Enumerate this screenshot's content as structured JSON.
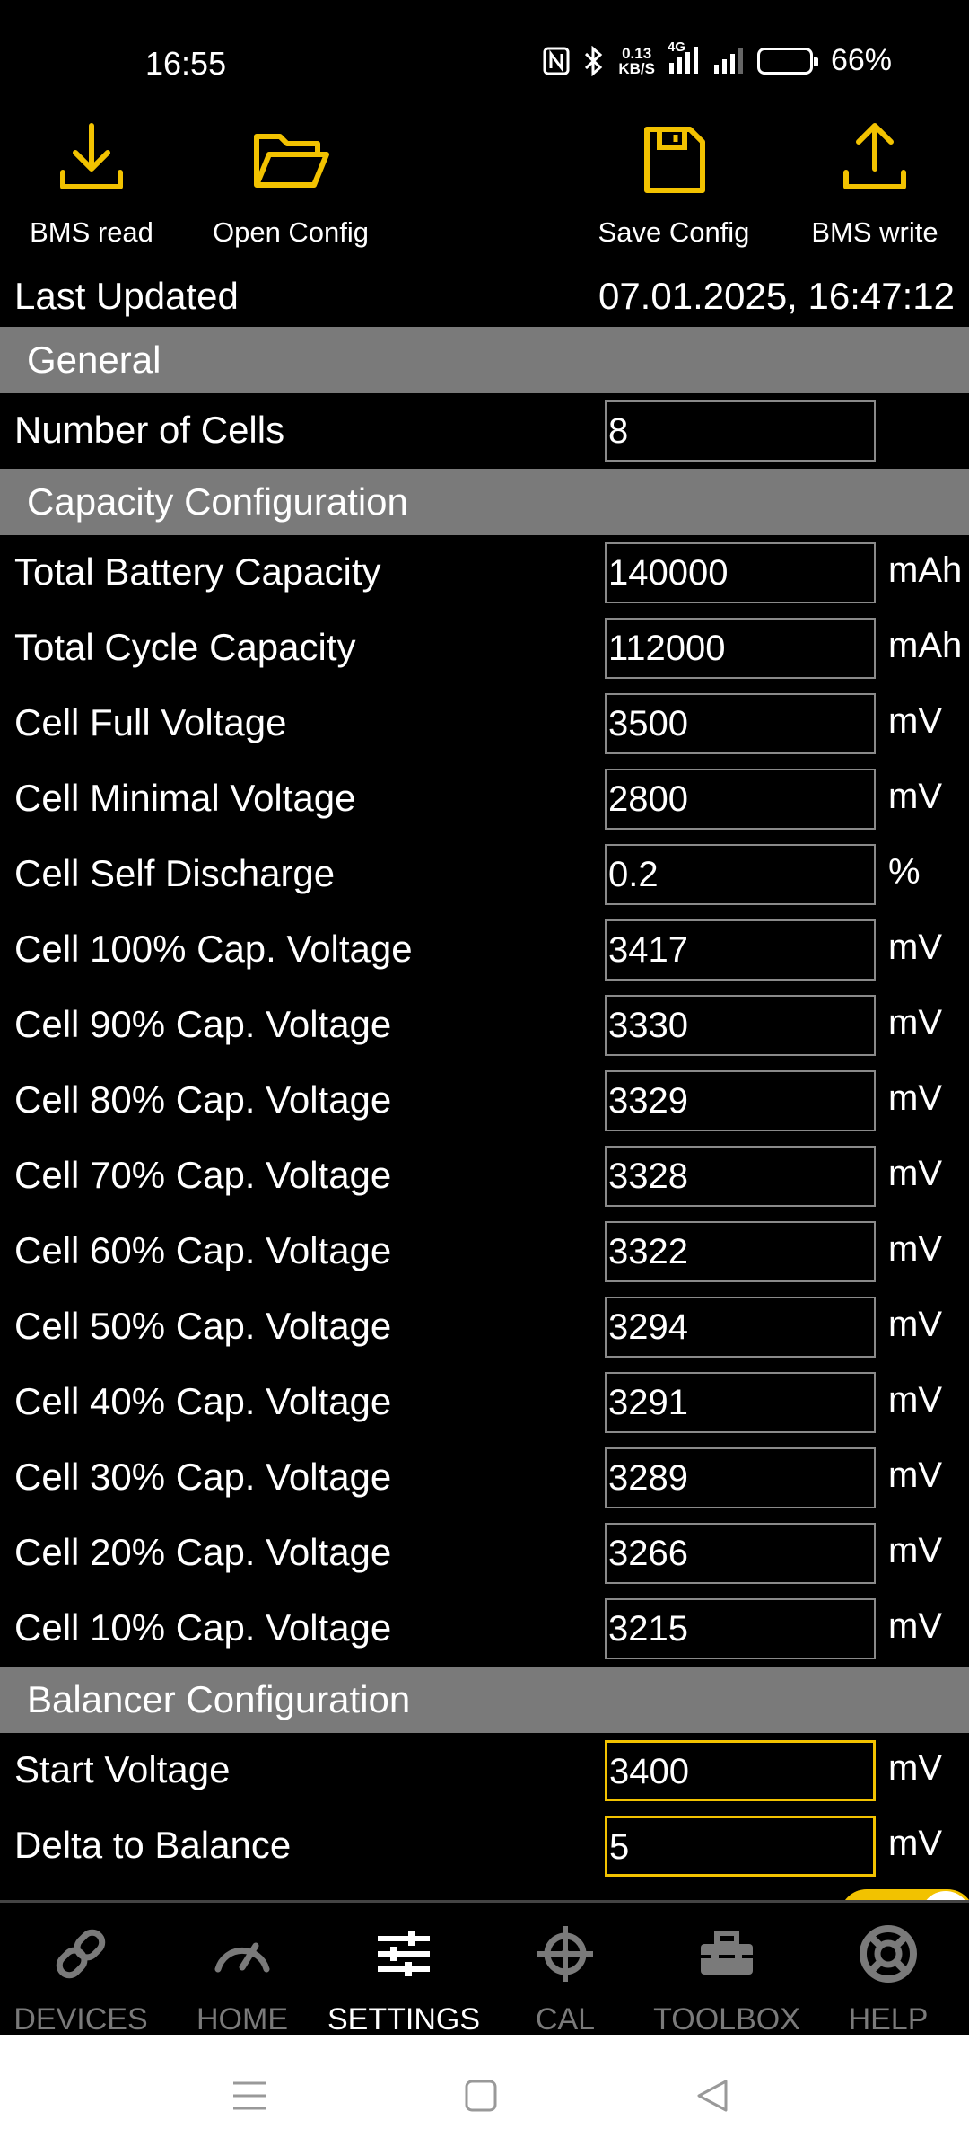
{
  "status_bar": {
    "time": "16:55",
    "speed_value": "0.13",
    "speed_unit": "KB/S",
    "network": "4G",
    "battery_percent": "66%",
    "battery_level": 0.66
  },
  "toolbar": {
    "bms_read": "BMS read",
    "open_config": "Open Config",
    "save_config": "Save Config",
    "bms_write": "BMS write",
    "accent_color": "#F2C200"
  },
  "last_updated": {
    "label": "Last Updated",
    "value": "07.01.2025, 16:47:12"
  },
  "sections": {
    "general": {
      "title": "General",
      "rows": [
        {
          "label": "Number of Cells",
          "value": "8",
          "unit": ""
        }
      ]
    },
    "capacity": {
      "title": "Capacity Configuration",
      "rows": [
        {
          "label": "Total Battery Capacity",
          "value": "140000",
          "unit": "mAh"
        },
        {
          "label": "Total Cycle Capacity",
          "value": "112000",
          "unit": "mAh"
        },
        {
          "label": "Cell Full Voltage",
          "value": "3500",
          "unit": "mV"
        },
        {
          "label": "Cell Minimal Voltage",
          "value": "2800",
          "unit": "mV"
        },
        {
          "label": "Cell Self Discharge",
          "value": "0.2",
          "unit": "%"
        },
        {
          "label": "Cell 100% Cap. Voltage",
          "value": "3417",
          "unit": "mV"
        },
        {
          "label": "Cell 90% Cap. Voltage",
          "value": "3330",
          "unit": "mV"
        },
        {
          "label": "Cell 80% Cap. Voltage",
          "value": "3329",
          "unit": "mV"
        },
        {
          "label": "Cell 70% Cap. Voltage",
          "value": "3328",
          "unit": "mV"
        },
        {
          "label": "Cell 60% Cap. Voltage",
          "value": "3322",
          "unit": "mV"
        },
        {
          "label": "Cell 50% Cap. Voltage",
          "value": "3294",
          "unit": "mV"
        },
        {
          "label": "Cell 40% Cap. Voltage",
          "value": "3291",
          "unit": "mV"
        },
        {
          "label": "Cell 30% Cap. Voltage",
          "value": "3289",
          "unit": "mV"
        },
        {
          "label": "Cell 20% Cap. Voltage",
          "value": "3266",
          "unit": "mV"
        },
        {
          "label": "Cell 10% Cap. Voltage",
          "value": "3215",
          "unit": "mV"
        }
      ]
    },
    "balancer": {
      "title": "Balancer Configuration",
      "rows": [
        {
          "label": "Start Voltage",
          "value": "3400",
          "unit": "mV"
        },
        {
          "label": "Delta to Balance",
          "value": "5",
          "unit": "mV"
        }
      ]
    }
  },
  "bottom_nav": {
    "devices": "DEVICES",
    "home": "HOME",
    "settings": "SETTINGS",
    "cal": "CAL",
    "toolbox": "TOOLBOX",
    "help": "HELP",
    "selected": "settings"
  },
  "icons": {
    "bms_read": "download-icon",
    "open_config": "folder-open-icon",
    "save_config": "floppy-disk-icon",
    "bms_write": "upload-icon",
    "devices": "link-icon",
    "home": "gauge-icon",
    "settings": "sliders-icon",
    "cal": "crosshair-icon",
    "toolbox": "toolbox-icon",
    "help": "lifebuoy-icon"
  }
}
